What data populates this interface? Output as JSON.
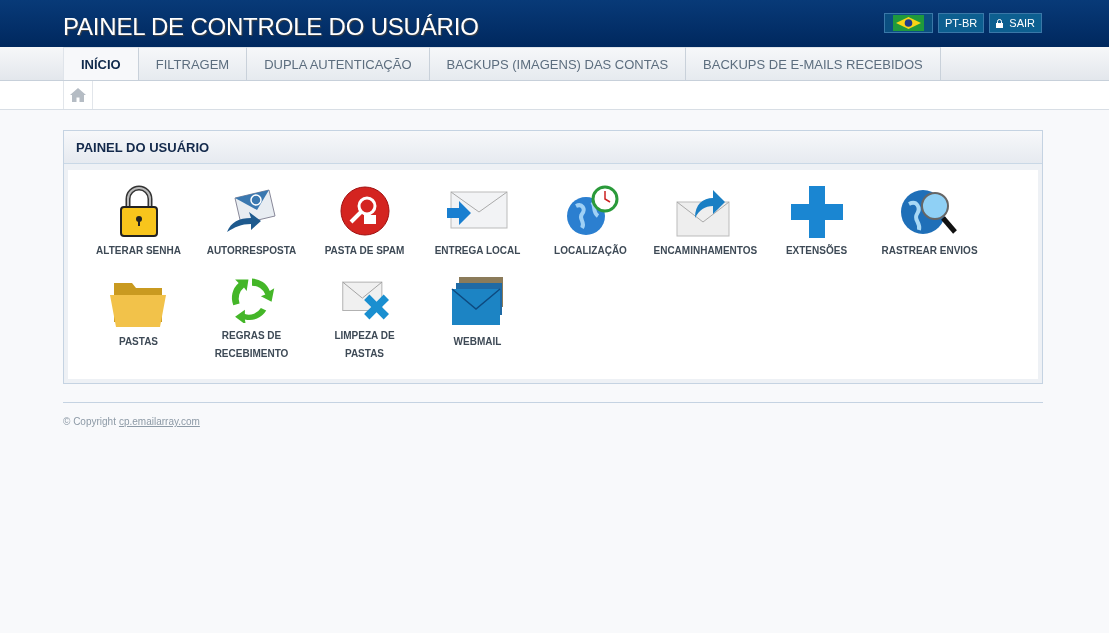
{
  "header": {
    "title": "PAINEL DE CONTROLE DO USUÁRIO",
    "language": "PT-BR",
    "logout": "SAIR"
  },
  "tabs": [
    {
      "label": "INÍCIO",
      "selected": true
    },
    {
      "label": "FILTRAGEM",
      "selected": false
    },
    {
      "label": "DUPLA AUTENTICAÇÃO",
      "selected": false
    },
    {
      "label": "BACKUPS (IMAGENS) DAS CONTAS",
      "selected": false
    },
    {
      "label": "BACKUPS DE E-MAILS RECEBIDOS",
      "selected": false
    }
  ],
  "panel": {
    "title": "PAINEL DO USUÁRIO",
    "items": [
      {
        "kind": "lock",
        "label": "ALTERAR SENHA"
      },
      {
        "kind": "autoreply",
        "label": "AUTORRESPOSTA"
      },
      {
        "kind": "spam",
        "label": "PASTA DE SPAM"
      },
      {
        "kind": "delivery",
        "label": "ENTREGA LOCAL"
      },
      {
        "kind": "globeclock",
        "label": "LOCALIZAÇÃO"
      },
      {
        "kind": "forward",
        "label": "ENCAMINHAMENTOS"
      },
      {
        "kind": "plus",
        "label": "EXTENSÕES"
      },
      {
        "kind": "globesearch",
        "label": "RASTREAR ENVIOS"
      },
      {
        "kind": "folder",
        "label": "PASTAS"
      },
      {
        "kind": "recycle",
        "label": "REGRAS DE RECEBIMENTO"
      },
      {
        "kind": "mailx",
        "label": "LIMPEZA DE PASTAS"
      },
      {
        "kind": "mailstack",
        "label": "WEBMAIL"
      }
    ]
  },
  "footer": {
    "text": "© Copyright",
    "link": "cp.emailarray.com"
  }
}
